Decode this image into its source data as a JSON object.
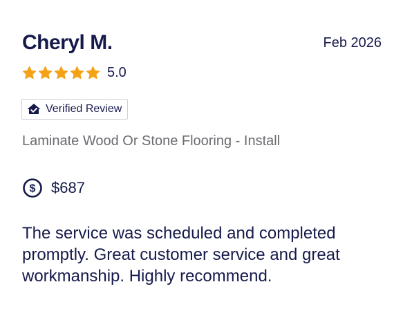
{
  "review": {
    "reviewer_name": "Cheryl M.",
    "date": "Feb 2026",
    "rating": 5,
    "rating_label": "5.0",
    "verified_label": "Verified Review",
    "service": "Laminate Wood Or Stone Flooring - Install",
    "price": "$687",
    "text": "The service was scheduled and completed promptly. Great customer service and great workmanship. Highly recommend."
  },
  "icons": {
    "star": "star-icon",
    "verified": "verified-house-icon",
    "price": "dollar-circle-icon"
  },
  "colors": {
    "star": "#f5a316",
    "text_primary": "#161a4b",
    "text_secondary": "#6b6b70",
    "badge_border": "#cfcfd6"
  }
}
